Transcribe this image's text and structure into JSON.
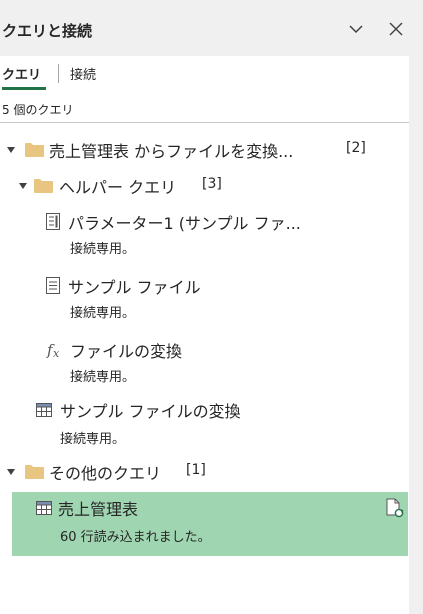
{
  "pane": {
    "title": "クエリと接続",
    "collapse_icon": "chevron-down-icon",
    "close_icon": "close-icon"
  },
  "tabs": {
    "queries": "クエリ",
    "connections": "接続"
  },
  "query_count": "5 個のクエリ",
  "tree": {
    "group1": {
      "label": "売上管理表 からファイルを変換...",
      "count": "[2]"
    },
    "group2": {
      "label": "ヘルパー クエリ",
      "count": "[3]"
    },
    "item_parameter": {
      "label": "パラメーター1 (サンプル ファ...",
      "status": "接続専用。",
      "icon": "parameter-icon"
    },
    "item_sample_file": {
      "label": "サンプル ファイル",
      "status": "接続専用。",
      "icon": "document-icon"
    },
    "item_transform_fn": {
      "label": "ファイルの変換",
      "status": "接続専用。",
      "icon": "fx-icon"
    },
    "item_transform_sample": {
      "label": "サンプル ファイルの変換",
      "status": "接続専用。",
      "icon": "table-icon"
    },
    "group3": {
      "label": "その他のクエリ",
      "count": "[1]"
    },
    "item_sales": {
      "label": "売上管理表",
      "status": "60 行読み込まれました。",
      "icon": "table-icon"
    }
  },
  "colors": {
    "accent": "#217346",
    "selected_row": "#9fd5b0",
    "folder": "#e8c580"
  }
}
